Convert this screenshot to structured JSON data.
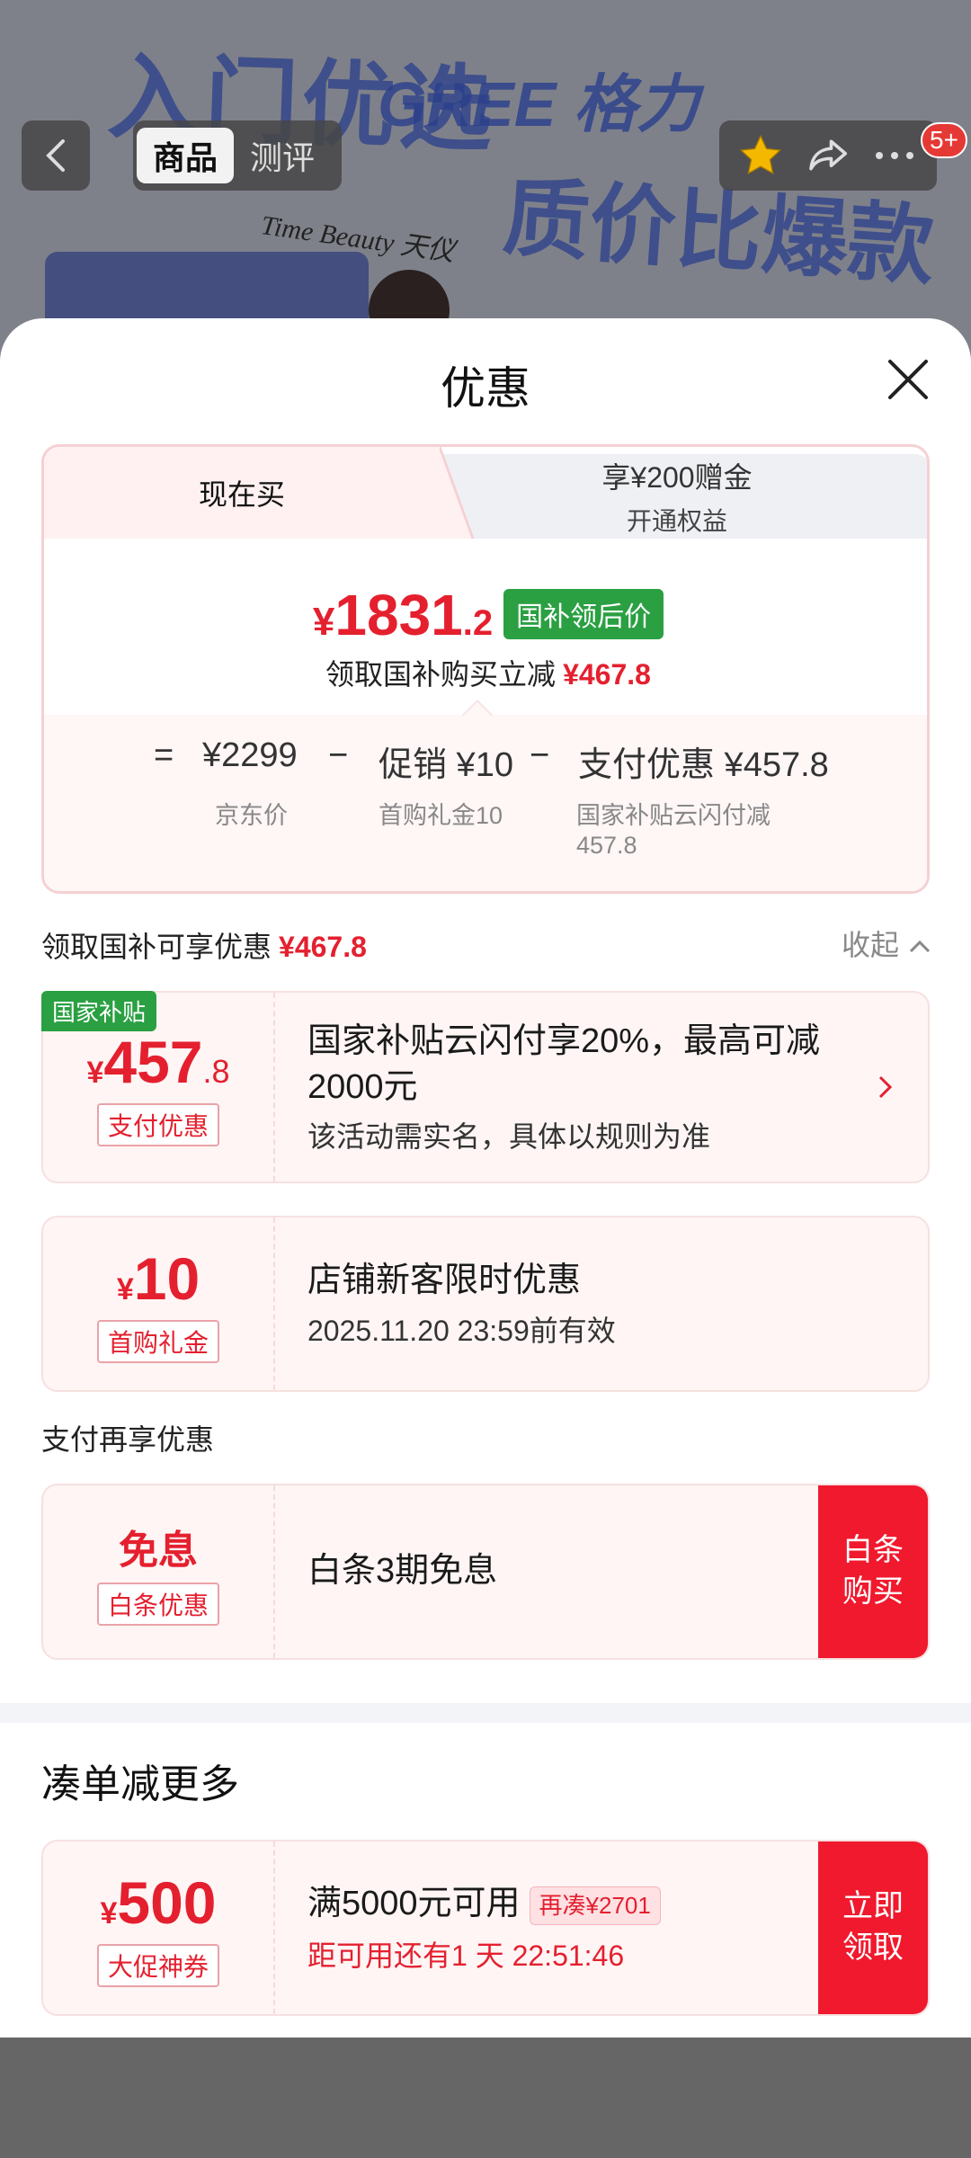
{
  "nav": {
    "tabs": [
      {
        "label": "商品",
        "active": true
      },
      {
        "label": "测评",
        "active": false
      }
    ],
    "badge": "5+"
  },
  "banner": {
    "headline": "入门优选 质价比爆款",
    "brand": "GREE 格力",
    "brand2": "Time Beauty 天仪"
  },
  "sheet": {
    "title": "优惠",
    "tabs": {
      "now": "现在买",
      "vip_line1": "享¥200赠金",
      "vip_line2": "开通权益"
    },
    "price": {
      "symbol": "¥",
      "integer": "1831",
      "decimal": ".2",
      "pill": "国补领后价",
      "sub_text": "领取国补购买立减",
      "sub_amount": "¥467.8"
    },
    "calc": {
      "eq": "=",
      "p1": "¥2299",
      "p1_label": "京东价",
      "minus1": "−",
      "p2": "促销 ¥10",
      "p2_label": "首购礼金10",
      "minus2": "−",
      "p3": "支付优惠 ¥457.8",
      "p3_label_1": "国家补贴云闪付减",
      "p3_label_2": "457.8"
    },
    "section": {
      "title": "领取国补可享优惠",
      "amount": "¥467.8",
      "collapse": "收起"
    },
    "coupons": [
      {
        "corner": "国家补贴",
        "symbol": "¥",
        "integer": "457",
        "decimal": ".8",
        "tag": "支付优惠",
        "title": "国家补贴云闪付享20%，最高可减2000元",
        "desc": "该活动需实名，具体以规则为准"
      },
      {
        "symbol": "¥",
        "integer": "10",
        "tag": "首购礼金",
        "title": "店铺新客限时优惠",
        "desc": "2025.11.20 23:59前有效"
      }
    ],
    "pay_section": {
      "title": "支付再享优惠",
      "value": "免息",
      "tag": "白条优惠",
      "desc": "白条3期免息",
      "btn_line1": "白条",
      "btn_line2": "购买"
    },
    "more": {
      "title": "凑单减更多",
      "symbol": "¥",
      "integer": "500",
      "tag": "大促神券",
      "cond": "满5000元可用",
      "re_tag": "再凑¥2701",
      "countdown": "距可用还有1 天 22:51:46",
      "btn_line1": "立即",
      "btn_line2": "领取"
    }
  },
  "colors": {
    "accent": "#e4202f",
    "green": "#2aa042",
    "button_red": "#f0192d"
  },
  "icons": [
    "back-arrow-icon",
    "star-icon",
    "share-icon",
    "more-icon",
    "close-icon",
    "chevron-up-icon",
    "chevron-right-icon"
  ]
}
